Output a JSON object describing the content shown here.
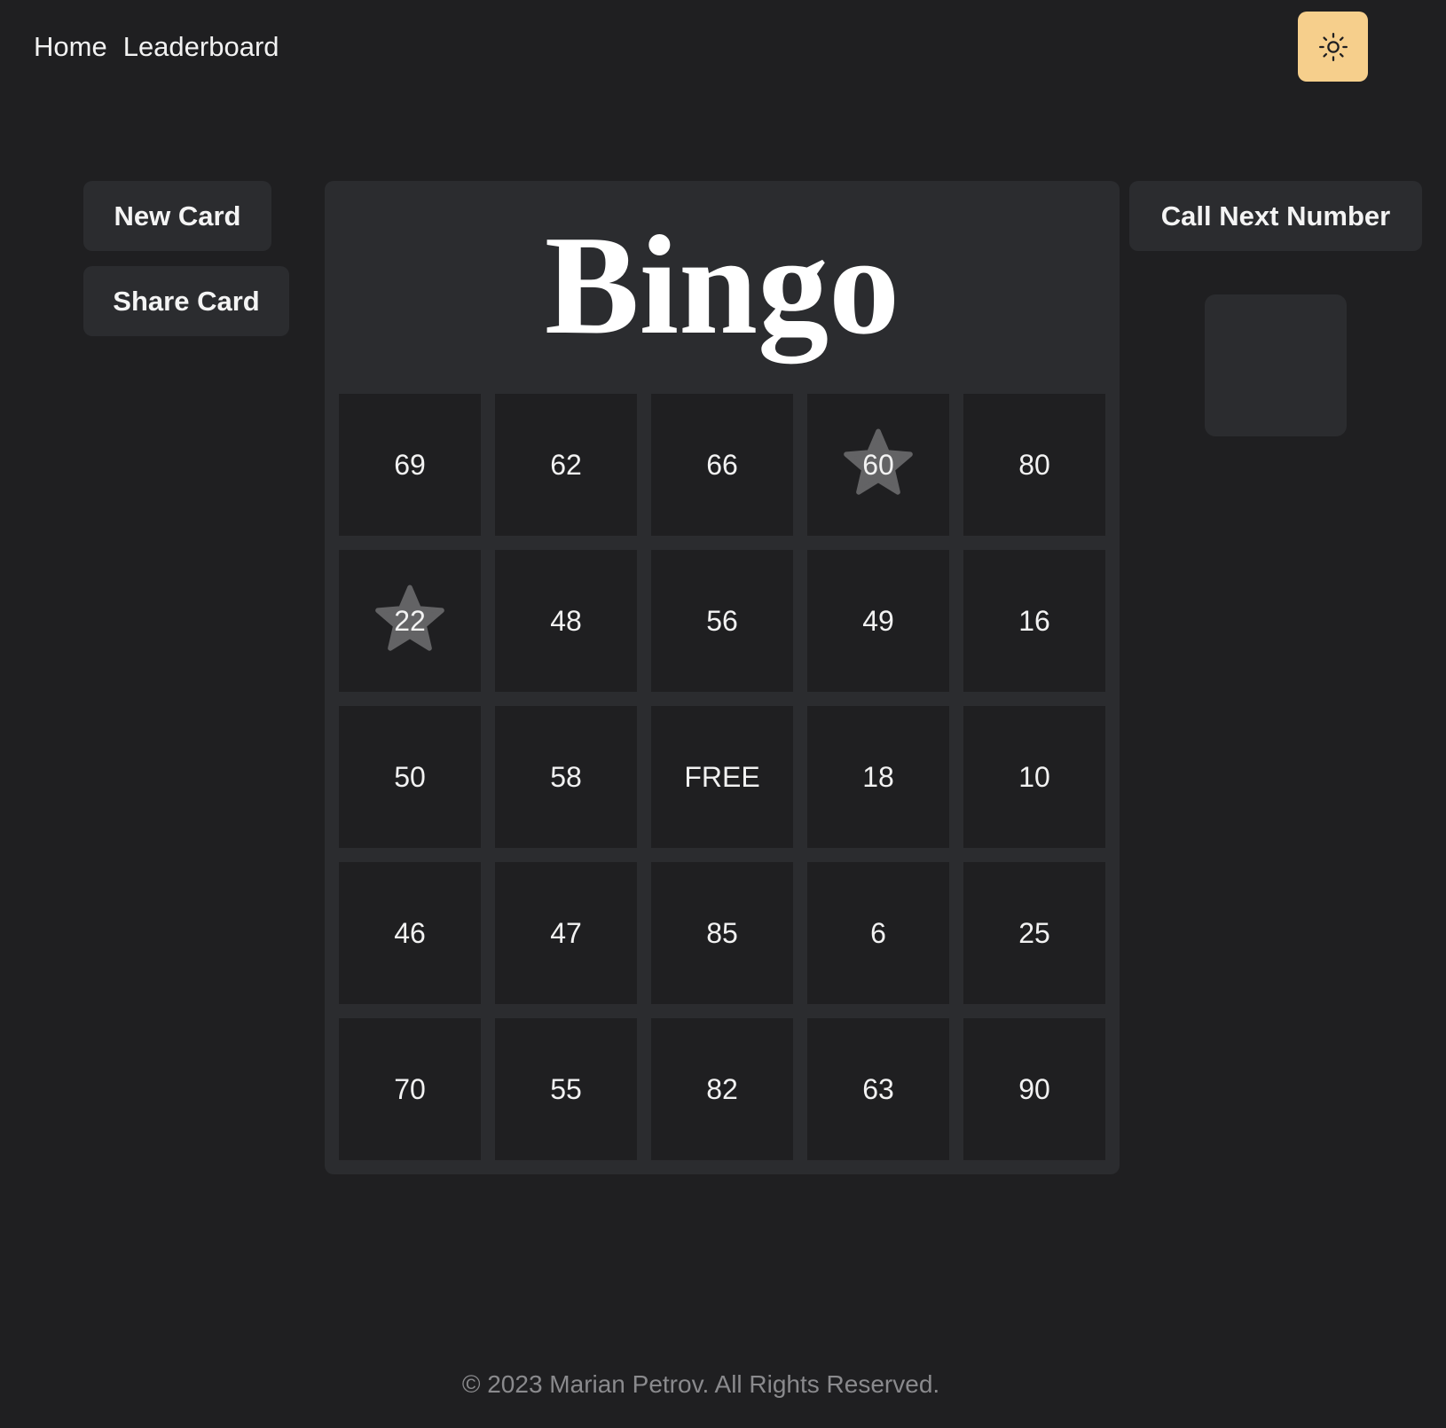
{
  "nav": {
    "home": "Home",
    "leaderboard": "Leaderboard"
  },
  "theme_toggle": {
    "icon": "sun-icon",
    "color": "#f6cf8c"
  },
  "buttons": {
    "new_card": "New Card",
    "share_card": "Share Card",
    "call_next": "Call Next Number"
  },
  "board": {
    "title": "Bingo",
    "cells": [
      {
        "value": "69",
        "marked": false
      },
      {
        "value": "62",
        "marked": false
      },
      {
        "value": "66",
        "marked": false
      },
      {
        "value": "60",
        "marked": true
      },
      {
        "value": "80",
        "marked": false
      },
      {
        "value": "22",
        "marked": true
      },
      {
        "value": "48",
        "marked": false
      },
      {
        "value": "56",
        "marked": false
      },
      {
        "value": "49",
        "marked": false
      },
      {
        "value": "16",
        "marked": false
      },
      {
        "value": "50",
        "marked": false
      },
      {
        "value": "58",
        "marked": false
      },
      {
        "value": "FREE",
        "marked": false
      },
      {
        "value": "18",
        "marked": false
      },
      {
        "value": "10",
        "marked": false
      },
      {
        "value": "46",
        "marked": false
      },
      {
        "value": "47",
        "marked": false
      },
      {
        "value": "85",
        "marked": false
      },
      {
        "value": "6",
        "marked": false
      },
      {
        "value": "25",
        "marked": false
      },
      {
        "value": "70",
        "marked": false
      },
      {
        "value": "55",
        "marked": false
      },
      {
        "value": "82",
        "marked": false
      },
      {
        "value": "63",
        "marked": false
      },
      {
        "value": "90",
        "marked": false
      }
    ]
  },
  "called_number": "",
  "footer": "© 2023 Marian Petrov. All Rights Reserved."
}
